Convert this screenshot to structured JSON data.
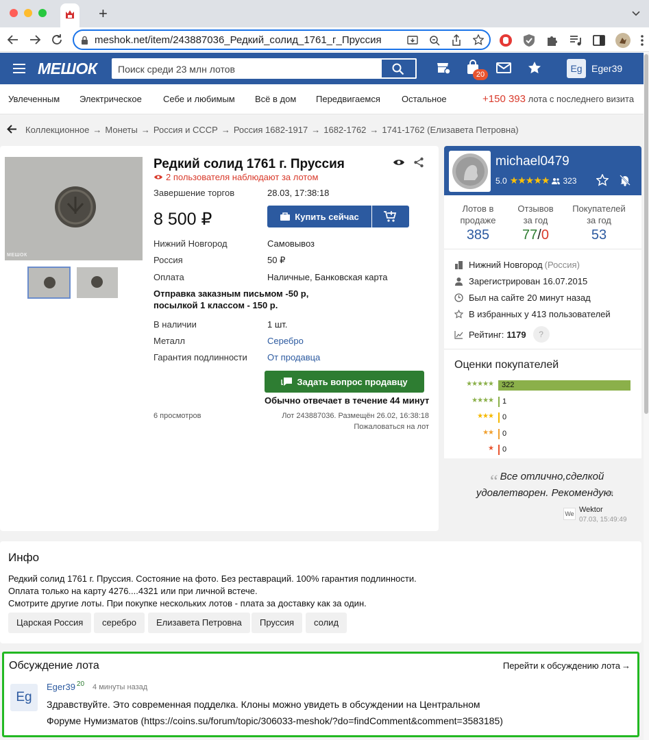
{
  "browser": {
    "url": "meshok.net/item/243887036_Редкий_солид_1761_г_Пруссия",
    "tab_badge": "20"
  },
  "header": {
    "logo": "МЕШОК",
    "search_placeholder": "Поиск среди 23 млн лотов",
    "cart_count": "20",
    "user": "Eger39",
    "avatar": "Eg"
  },
  "categories": [
    "Увлеченным",
    "Электрическое",
    "Себе и любимым",
    "Всё в дом",
    "Передвигаемся",
    "Остальное"
  ],
  "new_lots": {
    "count": "+150 393",
    "text": "лота с последнего визита"
  },
  "breadcrumb": [
    "Коллекционное",
    "Монеты",
    "Россия и СССР",
    "Россия 1682-1917",
    "1682-1762",
    "1741-1762 (Елизавета Петровна)"
  ],
  "lot": {
    "title": "Редкий солид 1761 г. Пруссия",
    "watchers": "2 пользователя наблюдают за лотом",
    "end_label": "Завершение торгов",
    "end_value": "28.03, 17:38:18",
    "price": "8 500 ₽",
    "buy_button": "Купить сейчас",
    "city": "Нижний Новгород",
    "pickup": "Самовывоз",
    "country": "Россия",
    "shipping_price": "50 ₽",
    "payment_label": "Оплата",
    "payment_value": "Наличные, Банковская карта",
    "shipping_note": "Отправка заказным письмом -50 р, посылкой 1 классом - 150 р.",
    "stock_label": "В наличии",
    "stock_value": "1 шт.",
    "metal_label": "Металл",
    "metal_value": "Серебро",
    "guarantee_label": "Гарантия подлинности",
    "guarantee_value": "От продавца",
    "ask_button": "Задать вопрос продавцу",
    "reply_time": "Обычно отвечает в течение 44 минут",
    "views": "6 просмотров",
    "lot_info": "Лот 243887036. Размещён 26.02, 16:38:18",
    "complain": "Пожаловаться на лот",
    "watermark": "МЕШОК"
  },
  "seller": {
    "name": "michael0479",
    "rating": "5.0",
    "followers": "323",
    "stats": [
      {
        "label": "Лотов в продаже",
        "value": "385"
      },
      {
        "label": "Отзывов за год",
        "value_good": "77",
        "value_bad": "0"
      },
      {
        "label": "Покупателей за год",
        "value": "53"
      }
    ],
    "city": "Нижний Новгород",
    "region": "(Россия)",
    "registered_label": "Зарегистрирован",
    "registered_date": "16.07.2015",
    "seen_label": "Был на сайте",
    "seen_value": "20 минут назад",
    "fav_label": "В избранных у",
    "fav_value": "413 пользователей",
    "rating_label": "Рейтинг:",
    "rating_value": "1179",
    "reviews_title": "Оценки покупателей",
    "review_bars": [
      {
        "stars": 5,
        "count": "322",
        "fraction": 1.0
      },
      {
        "stars": 4,
        "count": "1",
        "fraction": 0.003
      },
      {
        "stars": 3,
        "count": "0",
        "fraction": 0
      },
      {
        "stars": 2,
        "count": "0",
        "fraction": 0
      },
      {
        "stars": 1,
        "count": "0",
        "fraction": 0
      }
    ],
    "quote": "Все отлично,сделкой удовлетворен. Рекомендую.",
    "quote_author": "Wektor",
    "quote_avatar": "We",
    "quote_date": "07.03, 15:49:49"
  },
  "info": {
    "title": "Инфо",
    "lines": [
      "Редкий солид 1761 г. Пруссия. Состояние на фото. Без реставраций. 100% гарантия подлинности.",
      "Оплата только на карту 4276....4321 или при личной встече.",
      "Смотрите другие лоты. При покупке нескольких лотов - плата за доставку как за один."
    ],
    "tags": [
      "Царская Россия",
      "серебро",
      "Елизавета Петровна",
      "Пруссия",
      "солид"
    ]
  },
  "discussion": {
    "title": "Обсуждение лота",
    "link": "Перейти к обсуждению лота",
    "author": "Eger39",
    "author_badge": "20",
    "avatar": "Eg",
    "time": "4 минуты назад",
    "text1": "Здравствуйте. Это современная подделка. Клоны можно увидеть в обсуждении на Центральном",
    "text2": "Форуме Нумизматов (https://coins.su/forum/topic/306033-meshok/?do=findComment&comment=3583185)"
  },
  "colors": {
    "brand": "#2c5aa0",
    "green": "#2e7d32",
    "red": "#d93a2b",
    "highlight": "#22b822"
  }
}
